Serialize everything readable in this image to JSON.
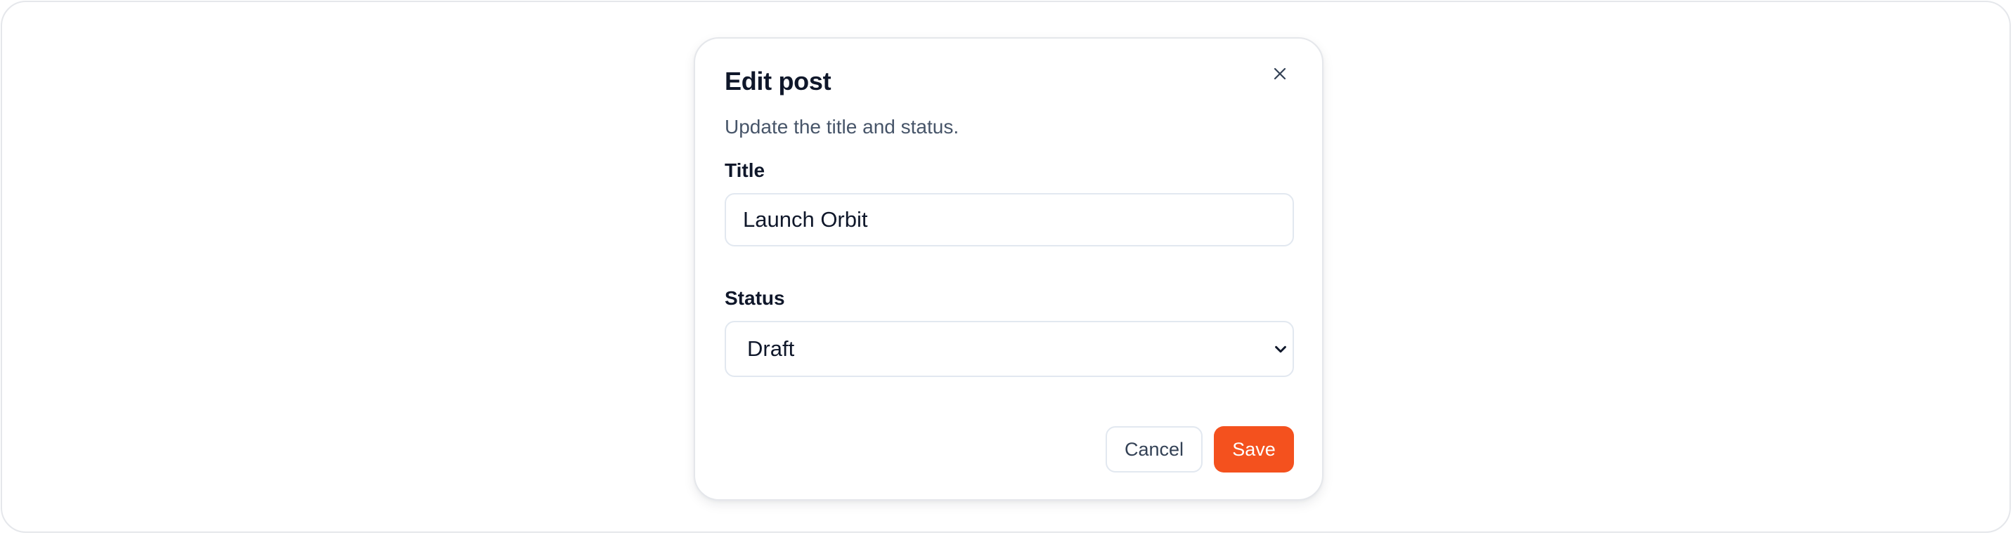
{
  "dialog": {
    "title": "Edit post",
    "subtitle": "Update the title and status.",
    "close_icon": "close-icon"
  },
  "form": {
    "title_label": "Title",
    "title_value": "Launch Orbit",
    "status_label": "Status",
    "status_value": "Draft",
    "status_chevron_icon": "chevron-down-icon"
  },
  "actions": {
    "cancel_label": "Cancel",
    "save_label": "Save"
  },
  "colors": {
    "accent": "#f4511e",
    "text_primary": "#0f172a",
    "text_secondary": "#475569",
    "border": "#e2e8f0"
  }
}
